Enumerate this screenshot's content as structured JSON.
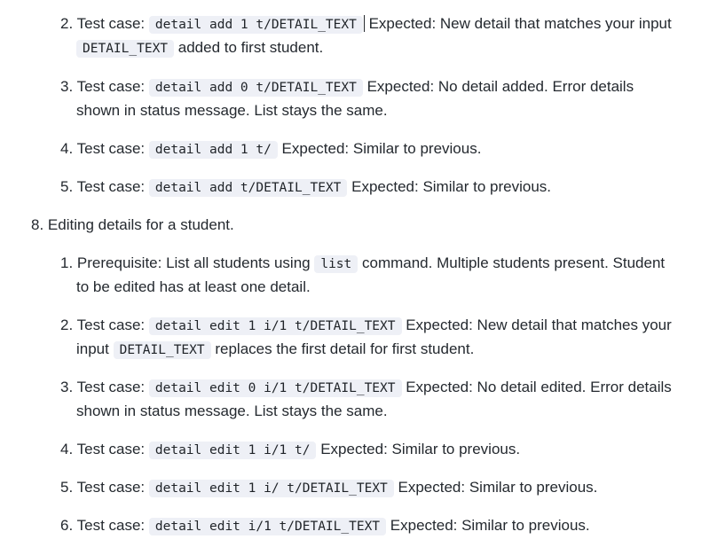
{
  "items": [
    {
      "num": "2.",
      "pre": "Test case: ",
      "code": "detail add 1 t/DETAIL_TEXT",
      "post": " Expected: New detail that matches your input",
      "line2_code": "DETAIL_TEXT",
      "line2_post": " added to first student."
    },
    {
      "num": "3.",
      "pre": "Test case: ",
      "code": "detail add 0 t/DETAIL_TEXT",
      "post": " Expected: No detail added. Error details",
      "line2": "shown in status message. List stays the same."
    },
    {
      "num": "4.",
      "pre": "Test case: ",
      "code": "detail add 1 t/",
      "post": " Expected: Similar to previous."
    },
    {
      "num": "5.",
      "pre": "Test case: ",
      "code": "detail add t/DETAIL_TEXT",
      "post": " Expected: Similar to previous."
    },
    {
      "num": "8.",
      "text": "Editing details for a student."
    },
    {
      "num": "1.",
      "pre": "Prerequisite: List all students using ",
      "code": "list",
      "post": " command. Multiple students present. Student",
      "line2": "to be edited has at least one detail."
    },
    {
      "num": "2.",
      "pre": "Test case: ",
      "code": "detail edit 1 i/1 t/DETAIL_TEXT",
      "post": " Expected: New detail that matches your",
      "line2_pre": "input ",
      "line2_code": "DETAIL_TEXT",
      "line2_post": " replaces the first detail for first student."
    },
    {
      "num": "3.",
      "pre": "Test case: ",
      "code": "detail edit 0 i/1 t/DETAIL_TEXT",
      "post": " Expected: No detail edited. Error details",
      "line2": "shown in status message. List stays the same."
    },
    {
      "num": "4.",
      "pre": "Test case: ",
      "code": "detail edit 1 i/1 t/",
      "post": " Expected: Similar to previous."
    },
    {
      "num": "5.",
      "pre": "Test case: ",
      "code": "detail edit 1 i/ t/DETAIL_TEXT",
      "post": " Expected: Similar to previous."
    },
    {
      "num": "6.",
      "pre": "Test case: ",
      "code": "detail edit i/1 t/DETAIL_TEXT",
      "post": " Expected: Similar to previous."
    }
  ]
}
